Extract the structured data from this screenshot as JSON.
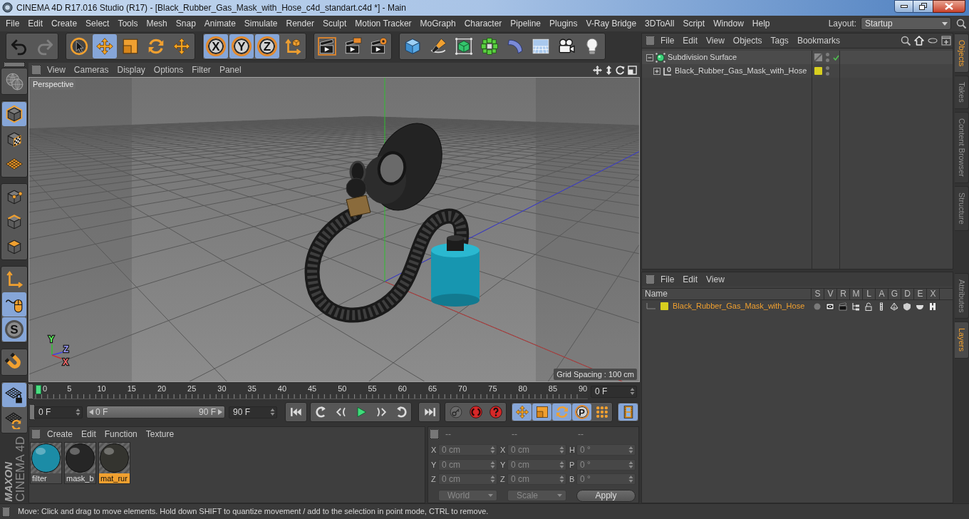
{
  "window": {
    "title": "CINEMA 4D R17.016 Studio (R17) - [Black_Rubber_Gas_Mask_with_Hose_c4d_standart.c4d *] - Main"
  },
  "menu_bar": {
    "items": [
      "File",
      "Edit",
      "Create",
      "Select",
      "Tools",
      "Mesh",
      "Snap",
      "Animate",
      "Simulate",
      "Render",
      "Sculpt",
      "Motion Tracker",
      "MoGraph",
      "Character",
      "Pipeline",
      "Plugins",
      "V-Ray Bridge",
      "3DToAll",
      "Script",
      "Window",
      "Help"
    ],
    "layout_label": "Layout:",
    "layout_value": "Startup"
  },
  "toolbar": [
    {
      "items": [
        {
          "kind": "undo",
          "disabled": false
        },
        {
          "kind": "redo",
          "disabled": true
        }
      ]
    },
    {
      "items": [
        {
          "kind": "select",
          "selected": false
        },
        {
          "kind": "move",
          "selected": true
        },
        {
          "kind": "scale",
          "selected": false
        },
        {
          "kind": "rotate",
          "selected": false
        },
        {
          "kind": "recent",
          "selected": false
        }
      ]
    },
    {
      "items": [
        {
          "kind": "axislock",
          "label": "X",
          "selected": true
        },
        {
          "kind": "axislock",
          "label": "Y",
          "selected": true
        },
        {
          "kind": "axislock",
          "label": "Z",
          "selected": true
        },
        {
          "kind": "coords",
          "selected": false
        }
      ]
    },
    {
      "items": [
        {
          "kind": "renderview"
        },
        {
          "kind": "renderpv"
        },
        {
          "kind": "rendersettings"
        }
      ]
    },
    {
      "items": [
        {
          "kind": "cube"
        },
        {
          "kind": "pen"
        },
        {
          "kind": "subdivision"
        },
        {
          "kind": "cloner"
        },
        {
          "kind": "deformer"
        },
        {
          "kind": "floor"
        },
        {
          "kind": "camera"
        },
        {
          "kind": "light"
        }
      ]
    }
  ],
  "left_toolbar": [
    {
      "items": [
        {
          "kind": "editable",
          "selected": false
        }
      ]
    },
    {
      "items": [
        {
          "kind": "model",
          "selected": true
        },
        {
          "kind": "texture",
          "selected": false
        },
        {
          "kind": "workplane",
          "selected": false
        }
      ]
    },
    {
      "items": [
        {
          "kind": "points",
          "selected": false
        },
        {
          "kind": "edges",
          "selected": false
        },
        {
          "kind": "polygons",
          "selected": false
        }
      ]
    },
    {
      "items": [
        {
          "kind": "axismode",
          "selected": false
        },
        {
          "kind": "tweak",
          "selected": true
        },
        {
          "kind": "solo",
          "label": "S",
          "selected": true
        }
      ]
    },
    {
      "items": [
        {
          "kind": "snap",
          "selected": false
        }
      ]
    },
    {
      "items": [
        {
          "kind": "planelock",
          "selected": true
        },
        {
          "kind": "planerotate",
          "selected": false
        }
      ]
    }
  ],
  "viewport": {
    "menu": [
      "View",
      "Cameras",
      "Display",
      "Options",
      "Filter",
      "Panel"
    ],
    "camera": "Perspective",
    "grid_spacing": "Grid Spacing : 100 cm",
    "axis_labels": [
      "Y",
      "Z",
      "X"
    ]
  },
  "timeline": {
    "ticks": [
      "0",
      "5",
      "10",
      "15",
      "20",
      "25",
      "30",
      "35",
      "40",
      "45",
      "50",
      "55",
      "60",
      "65",
      "70",
      "75",
      "80",
      "85",
      "90"
    ],
    "playhead": {
      "level": 0
    },
    "current_frame": "0 F"
  },
  "transport": {
    "start_frame": "0 F",
    "range": {
      "start": "0 F",
      "end": "90 F",
      "level": 1
    },
    "end_frame": "90 F",
    "groups": [
      {
        "items": [
          {
            "kind": "tostart"
          }
        ]
      },
      {
        "items": [
          {
            "kind": "prevkey"
          },
          {
            "kind": "prevframe"
          },
          {
            "kind": "play"
          },
          {
            "kind": "nextframe"
          },
          {
            "kind": "nextkey"
          }
        ]
      },
      {
        "items": [
          {
            "kind": "toend"
          }
        ]
      },
      {
        "items": [
          {
            "kind": "autokey",
            "disabled": true
          },
          {
            "kind": "record",
            "disabled": false
          },
          {
            "kind": "keyframe",
            "disabled": false
          }
        ]
      },
      {
        "items": [
          {
            "kind": "keymove",
            "selected": true
          },
          {
            "kind": "keyscale",
            "selected": true
          },
          {
            "kind": "keyrotate",
            "selected": true
          },
          {
            "kind": "keyparam",
            "label": "P",
            "selected": true
          },
          {
            "kind": "keypla",
            "selected": false
          }
        ]
      },
      {
        "items": [
          {
            "kind": "timeline",
            "selected": true
          }
        ]
      }
    ]
  },
  "logo": {
    "brand": "MAXON",
    "product": "CINEMA 4D"
  },
  "materials": {
    "menu": [
      "Create",
      "Edit",
      "Function",
      "Texture"
    ],
    "items": [
      {
        "name": "filter",
        "color": "#1c8ca6",
        "selected": false
      },
      {
        "name": "mask_b",
        "color": "#262626",
        "selected": false
      },
      {
        "name": "mat_rur",
        "color": "#34342f",
        "selected": true
      }
    ]
  },
  "coordinates": {
    "headers": [
      "--",
      "--",
      "--"
    ],
    "disabled": true,
    "rows": [
      {
        "cells": [
          {
            "label": "X",
            "value": "0 cm"
          },
          {
            "label": "X",
            "value": "0 cm"
          },
          {
            "label": "H",
            "value": "0 °"
          }
        ]
      },
      {
        "cells": [
          {
            "label": "Y",
            "value": "0 cm"
          },
          {
            "label": "Y",
            "value": "0 cm"
          },
          {
            "label": "P",
            "value": "0 °"
          }
        ]
      },
      {
        "cells": [
          {
            "label": "Z",
            "value": "0 cm"
          },
          {
            "label": "Z",
            "value": "0 cm"
          },
          {
            "label": "B",
            "value": "0 °"
          }
        ]
      }
    ],
    "mode": "World",
    "transform": "Scale",
    "apply": "Apply"
  },
  "status_bar": {
    "text": "Move: Click and drag to move elements. Hold down SHIFT to quantize movement / add to the selection in point mode, CTRL to remove."
  },
  "object_manager": {
    "menu": [
      "File",
      "Edit",
      "View",
      "Objects",
      "Tags",
      "Bookmarks"
    ],
    "objects": [
      {
        "kind": "subdivision",
        "name": "Subdivision Surface",
        "expanded": true,
        "enabled": true,
        "children": [
          {
            "kind": "null",
            "name": "Black_Rubber_Gas_Mask_with_Hose",
            "expanded": false,
            "color": "#d8cf1f"
          }
        ]
      }
    ]
  },
  "object_tabs": [
    {
      "label": "Objects",
      "selected": true
    },
    {
      "label": "Takes",
      "selected": false
    },
    {
      "label": "Content Browser",
      "selected": false
    },
    {
      "label": "Structure",
      "selected": false
    }
  ],
  "layer_manager": {
    "menu": [
      "File",
      "Edit",
      "View"
    ],
    "columns": [
      "Name",
      "S",
      "V",
      "R",
      "M",
      "L",
      "A",
      "G",
      "D",
      "E",
      "X"
    ],
    "layers": [
      {
        "name": "Black_Rubber_Gas_Mask_with_Hose",
        "color": "#d8cf1f"
      }
    ]
  },
  "layer_tabs": [
    {
      "label": "Attributes",
      "selected": false
    },
    {
      "label": "Layers",
      "selected": true
    }
  ]
}
